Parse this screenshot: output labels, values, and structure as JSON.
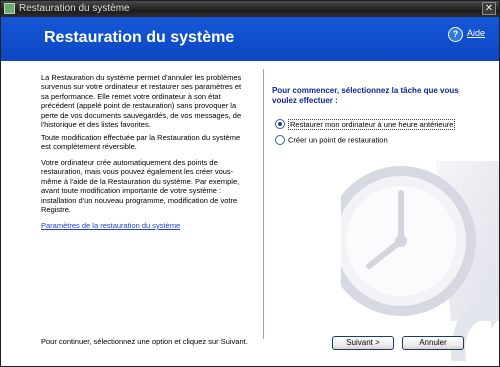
{
  "window": {
    "title": "Restauration du système",
    "close_glyph": "✕"
  },
  "header": {
    "title": "Restauration du système",
    "help_glyph": "?",
    "help_label": "Aide"
  },
  "left": {
    "paragraph1": "La Restauration du système permet d'annuler les problèmes survenus sur votre ordinateur et restaurer ses paramètres et sa performance. Elle remet votre ordinateur à son état précédent (appelé point de restauration) sans provoquer la perte de vos documents sauvegardés, de vos messages, de l'historique et des listes favorites.",
    "paragraph2": "Toute modification effectuée par la Restauration du système est complètement réversible.",
    "paragraph3": "Votre ordinateur crée automatiquement des points de restauration, mais vous pouvez également les créer vous-même à l'aide de la Restauration du système. Par exemple, avant toute modification importante de votre système : installation d'un nouveau programme, modification de votre Registre.",
    "settings_link": "Paramètres de la restauration du système"
  },
  "right": {
    "heading": "Pour commencer, sélectionnez la tâche que vous voulez effectuer :",
    "options": [
      {
        "label": "Restaurer mon ordinateur à une heure antérieure",
        "checked": true
      },
      {
        "label": "Créer un point de restauration",
        "checked": false
      }
    ]
  },
  "footer": {
    "instruction": "Pour continuer, sélectionnez une option et cliquez sur Suivant.",
    "next_label": "Suivant >",
    "cancel_label": "Annuler"
  },
  "colors": {
    "header_blue": "#0d47c3",
    "heading_text": "#15249b",
    "link": "#1a3fd1"
  },
  "icons": [
    "app-icon",
    "close-icon",
    "help-icon",
    "radio-checked-icon",
    "radio-unchecked-icon",
    "clock-illustration"
  ]
}
